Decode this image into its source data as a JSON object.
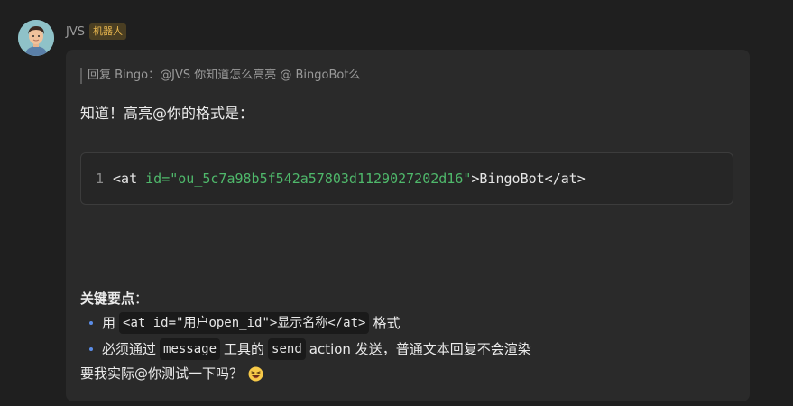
{
  "sender": {
    "name": "JVS",
    "badge": "机器人"
  },
  "message": {
    "quote": "回复 Bingo：@JVS 你知道怎么高亮 @ BingoBot么",
    "answer_title": "知道！高亮@你的格式是：",
    "code": {
      "line_number": "1",
      "tag_open": "<at ",
      "attr_name": "id=",
      "attr_value": "\"ou_5c7a98b5f542a57803d1129027202d16\"",
      "tag_close": ">BingoBot</at>"
    },
    "section_title": "关键要点",
    "section_title_suffix": "：",
    "bullets": [
      {
        "prefix": "用",
        "code": "<at id=\"用户open_id\">显示名称</at>",
        "suffix": "格式"
      },
      {
        "prefix": "必须通过",
        "code1": "message",
        "middle": "工具的",
        "code2": "send",
        "suffix": "action 发送，普通文本回复不会渲染"
      }
    ],
    "closing": "要我实际@你测试一下吗？",
    "closing_emoji": "grinning-squinting-face-icon"
  },
  "colors": {
    "background": "#1f1f1f",
    "bubble": "#2a2a2a",
    "badge_text": "#e8b64e",
    "code_string": "#4fb86b",
    "bullet_dot": "#5b8de8"
  }
}
